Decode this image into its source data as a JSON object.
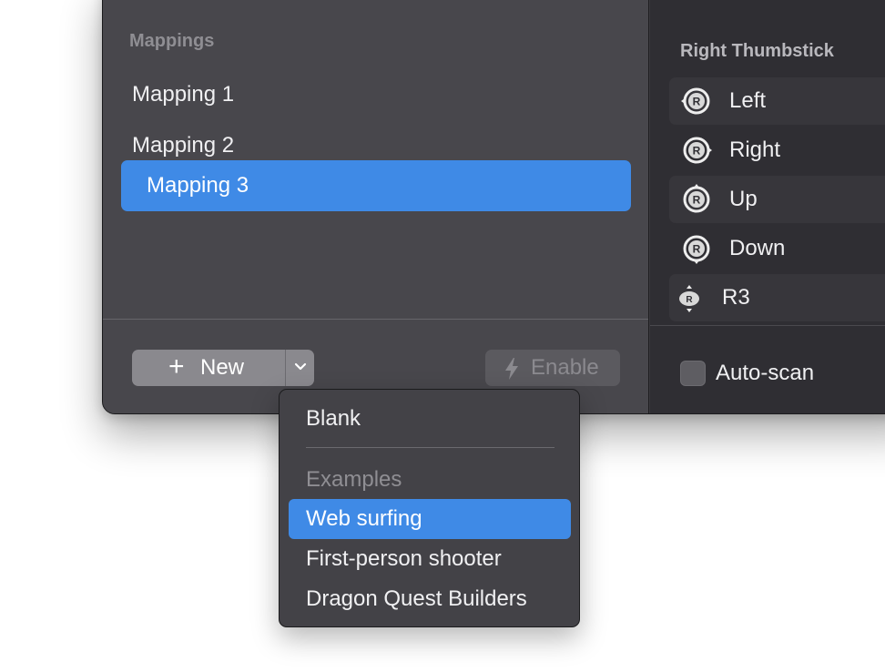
{
  "sidebar": {
    "section_title": "Mappings",
    "items": [
      {
        "label": "Mapping 1",
        "selected": false
      },
      {
        "label": "Mapping 2",
        "selected": false
      },
      {
        "label": "Mapping 3",
        "selected": true
      }
    ]
  },
  "footer": {
    "new_label": "New",
    "new_icon": "plus-icon",
    "dropdown_icon": "chevron-down-icon",
    "enable_label": "Enable",
    "enable_icon": "lightning-bolt-icon",
    "enable_disabled": true
  },
  "right_panel": {
    "title": "Right Thumbstick",
    "rows": [
      {
        "label": "Left",
        "icon": "right-stick-left-icon"
      },
      {
        "label": "Right",
        "icon": "right-stick-right-icon"
      },
      {
        "label": "Up",
        "icon": "right-stick-up-icon"
      },
      {
        "label": "Down",
        "icon": "right-stick-down-icon"
      },
      {
        "label": "R3",
        "icon": "right-stick-press-icon"
      }
    ],
    "auto_scan_label": "Auto-scan",
    "auto_scan_checked": false
  },
  "new_menu": {
    "blank_label": "Blank",
    "examples_header": "Examples",
    "examples": [
      {
        "label": "Web surfing",
        "highlighted": true
      },
      {
        "label": "First-person shooter",
        "highlighted": false
      },
      {
        "label": "Dragon Quest Builders",
        "highlighted": false
      }
    ]
  },
  "colors": {
    "accent": "#3f8ae6",
    "sidebar_bg": "#48474c",
    "panel_bg": "#2f2e33",
    "menu_bg": "#434247"
  }
}
